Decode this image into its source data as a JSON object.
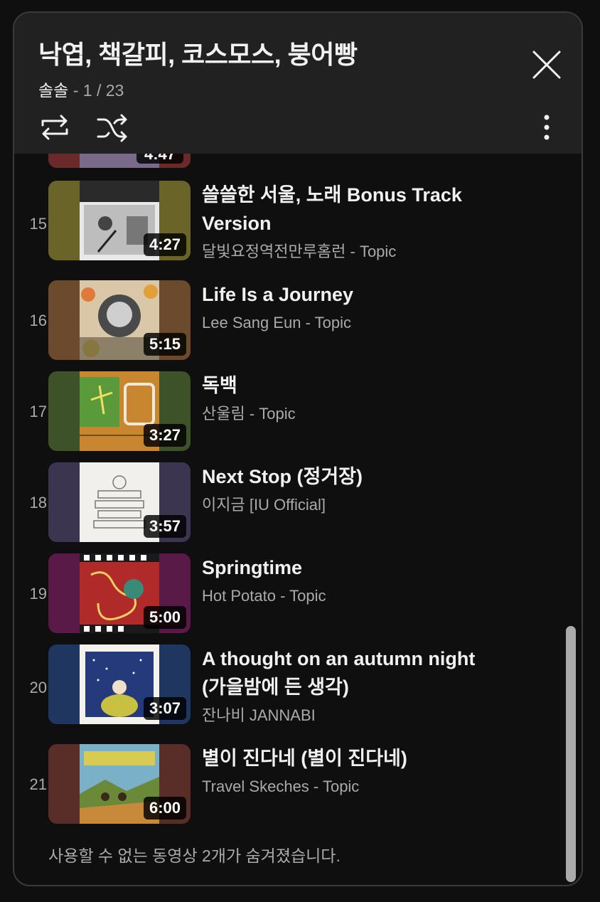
{
  "playlist": {
    "title": "낙엽, 책갈피, 코스모스, 붕어빵",
    "owner": "솔솔",
    "position": " - 1 / 23"
  },
  "icons": {
    "close": "close-icon",
    "loop": "loop-icon",
    "shuffle": "shuffle-icon",
    "more": "more-vert-icon"
  },
  "items": [
    {
      "index": "15",
      "title": "쓸쓸한 서울, 노래 Bonus Track Version",
      "channel": "달빛요정역전만루홈런 - Topic",
      "duration": "4:27",
      "bg": "#6b6428"
    },
    {
      "index": "16",
      "title": "Life Is a Journey",
      "channel": "Lee Sang Eun - Topic",
      "duration": "5:15",
      "bg": "#6b4a2e"
    },
    {
      "index": "17",
      "title": "독백",
      "channel": "산울림 - Topic",
      "duration": "3:27",
      "bg": "#3d5228"
    },
    {
      "index": "18",
      "title": "Next Stop (정거장)",
      "channel": "이지금 [IU Official]",
      "duration": "3:57",
      "bg": "#3c3550"
    },
    {
      "index": "19",
      "title": "Springtime",
      "channel": "Hot Potato - Topic",
      "duration": "5:00",
      "bg": "#5a1a48"
    },
    {
      "index": "20",
      "title": "A thought on an autumn night (가을밤에 든 생각)",
      "channel": "잔나비 JANNABI",
      "duration": "3:07",
      "bg": "#1e3660"
    },
    {
      "index": "21",
      "title": "별이 진다네 (별이 진다네)",
      "channel": "Travel Skeches - Topic",
      "duration": "6:00",
      "bg": "#5a2e28"
    }
  ],
  "partial_item": {
    "duration": "4:47"
  },
  "hidden_note": "사용할 수 없는 동영상 2개가 숨겨졌습니다."
}
